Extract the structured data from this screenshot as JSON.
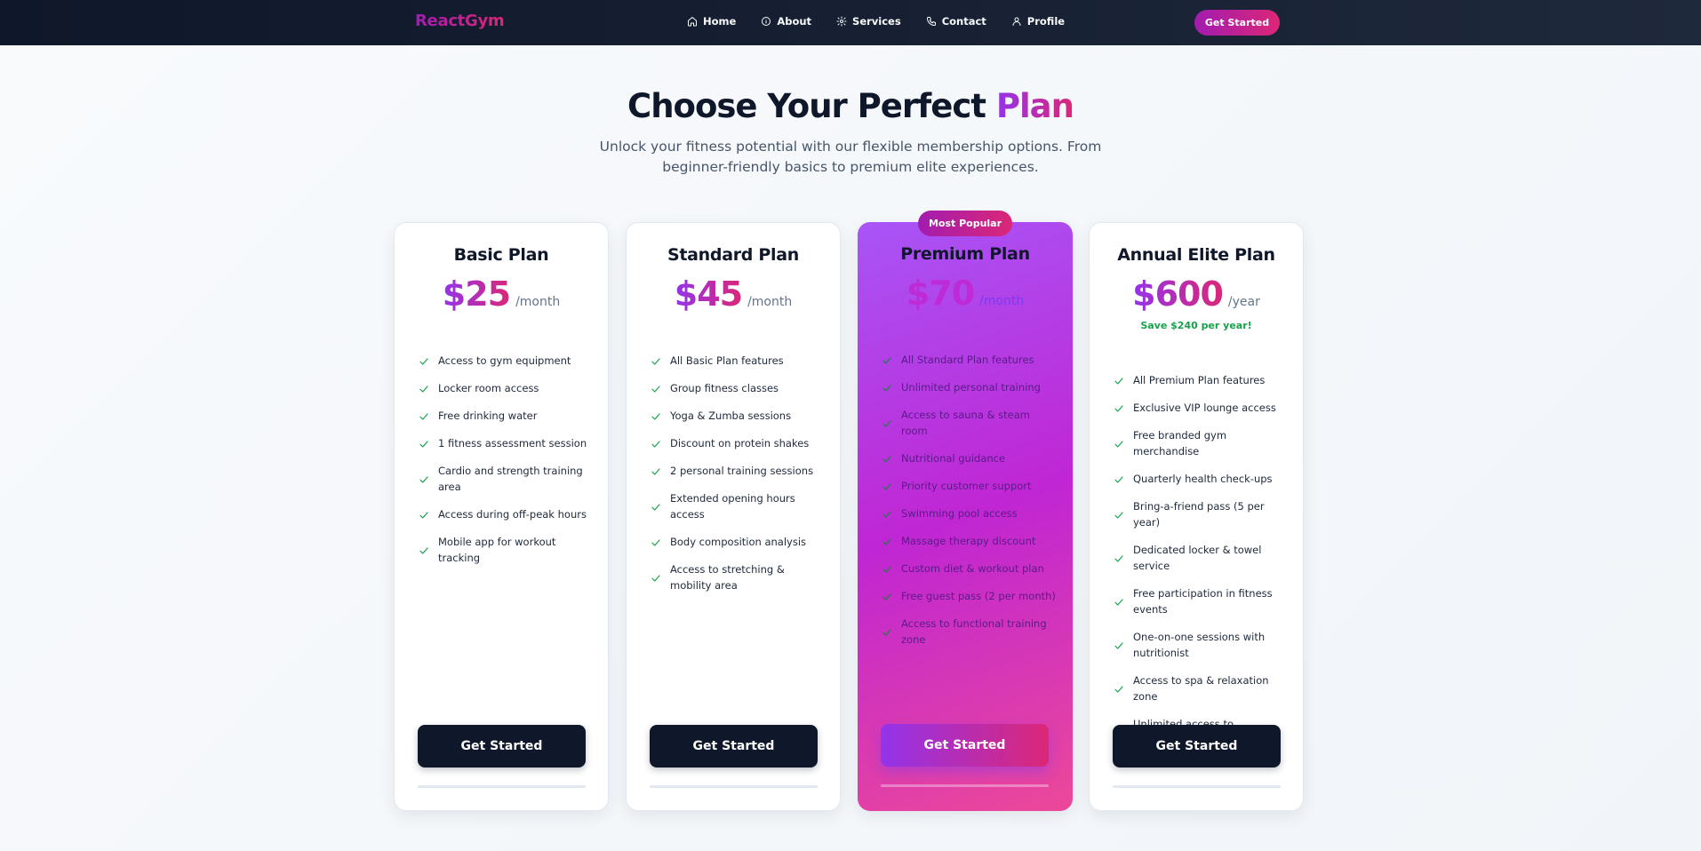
{
  "nav": {
    "brand": "ReactGym",
    "links": [
      {
        "label": "Home",
        "icon": "home-icon"
      },
      {
        "label": "About",
        "icon": "info-icon"
      },
      {
        "label": "Services",
        "icon": "gear-icon"
      },
      {
        "label": "Contact",
        "icon": "phone-icon"
      },
      {
        "label": "Profile",
        "icon": "user-icon"
      }
    ],
    "cta": "Get Started"
  },
  "hero": {
    "title_main": "Choose Your Perfect",
    "title_accent": "Plan",
    "subtitle": "Unlock your fitness potential with our flexible membership options. From beginner-friendly basics to premium elite experiences."
  },
  "colors": {
    "accent_start": "#9333ea",
    "accent_end": "#db2777",
    "check": "#16a34a",
    "dark": "#0f172a"
  },
  "plans": [
    {
      "name": "Basic Plan",
      "price": "$25",
      "period": "/month",
      "features": [
        "Access to gym equipment",
        "Locker room access",
        "Free drinking water",
        "1 fitness assessment session",
        "Cardio and strength training area",
        "Access during off-peak hours",
        "Mobile app for workout tracking"
      ],
      "cta": "Get Started"
    },
    {
      "name": "Standard Plan",
      "price": "$45",
      "period": "/month",
      "features": [
        "All Basic Plan features",
        "Group fitness classes",
        "Yoga & Zumba sessions",
        "Discount on protein shakes",
        "2 personal training sessions",
        "Extended opening hours access",
        "Body composition analysis",
        "Access to stretching & mobility area"
      ],
      "cta": "Get Started"
    },
    {
      "name": "Premium Plan",
      "badge": "Most Popular",
      "price": "$70",
      "period": "/month",
      "features": [
        "All Standard Plan features",
        "Unlimited personal training",
        "Access to sauna & steam room",
        "Nutritional guidance",
        "Priority customer support",
        "Swimming pool access",
        "Massage therapy discount",
        "Custom diet & workout plan",
        "Free guest pass (2 per month)",
        "Access to functional training zone"
      ],
      "cta": "Get Started"
    },
    {
      "name": "Annual Elite Plan",
      "price": "$600",
      "period": "/year",
      "savings": "Save $240 per year!",
      "features": [
        "All Premium Plan features",
        "Exclusive VIP lounge access",
        "Free branded gym merchandise",
        "Quarterly health check-ups",
        "Bring-a-friend pass (5 per year)",
        "Dedicated locker & towel service",
        "Free participation in fitness events",
        "One-on-one sessions with nutritionist",
        "Access to spa & relaxation zone",
        "Unlimited access to workshops & seminars"
      ],
      "cta": "Get Started"
    }
  ]
}
